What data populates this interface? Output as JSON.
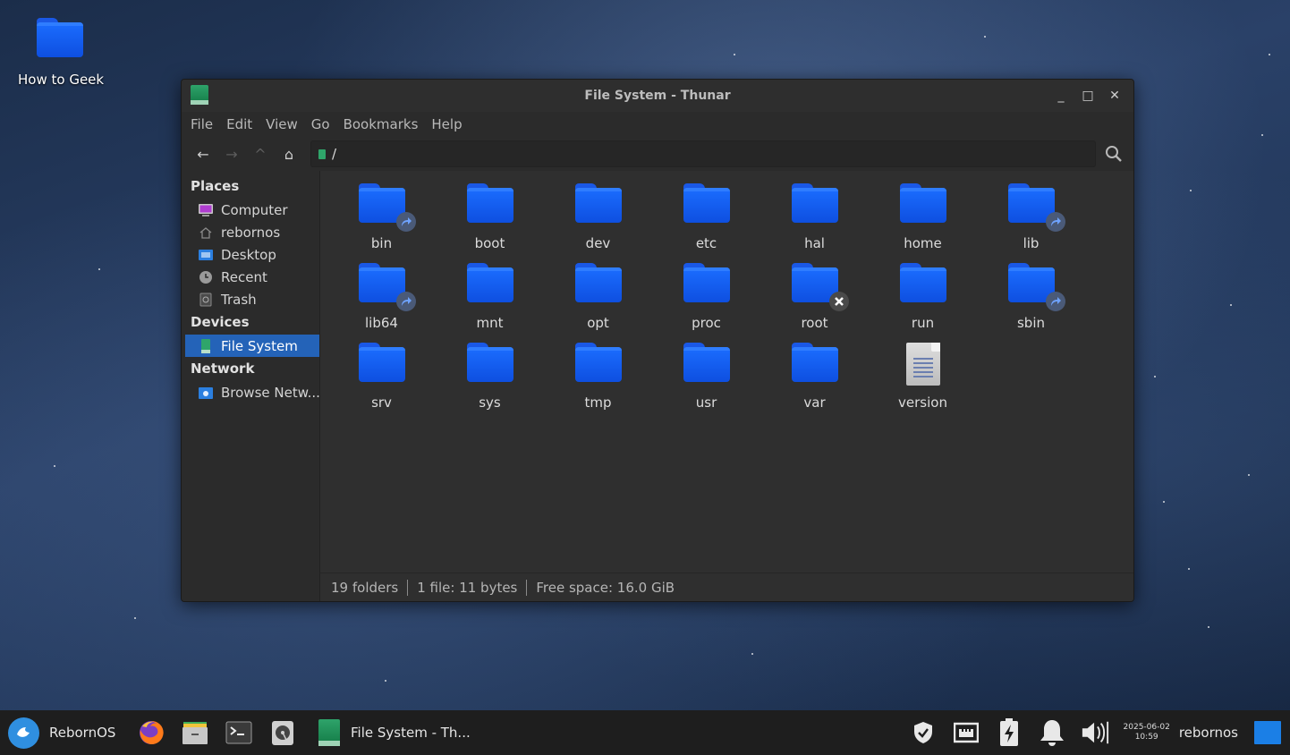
{
  "desktop": {
    "icon_label": "How to Geek"
  },
  "window": {
    "title": "File System - Thunar",
    "controls": {
      "minimize": "_",
      "maximize": "□",
      "close": "✕"
    },
    "menu": [
      "File",
      "Edit",
      "View",
      "Go",
      "Bookmarks",
      "Help"
    ],
    "toolbar": {
      "back": "←",
      "forward": "→",
      "up": "^",
      "home": "⌂",
      "location": "/"
    },
    "sidebar": {
      "places_header": "Places",
      "places": [
        {
          "label": "Computer",
          "icon": "computer-icon"
        },
        {
          "label": "rebornos",
          "icon": "home-icon"
        },
        {
          "label": "Desktop",
          "icon": "desktop-icon"
        },
        {
          "label": "Recent",
          "icon": "clock-icon"
        },
        {
          "label": "Trash",
          "icon": "trash-icon"
        }
      ],
      "devices_header": "Devices",
      "devices": [
        {
          "label": "File System",
          "icon": "drive-icon",
          "active": true
        }
      ],
      "network_header": "Network",
      "network": [
        {
          "label": "Browse Netw...",
          "icon": "network-icon"
        }
      ]
    },
    "files": [
      {
        "name": "bin",
        "type": "folder",
        "badge": "link"
      },
      {
        "name": "boot",
        "type": "folder"
      },
      {
        "name": "dev",
        "type": "folder"
      },
      {
        "name": "etc",
        "type": "folder"
      },
      {
        "name": "hal",
        "type": "folder"
      },
      {
        "name": "home",
        "type": "folder"
      },
      {
        "name": "lib",
        "type": "folder",
        "badge": "link"
      },
      {
        "name": "lib64",
        "type": "folder",
        "badge": "link"
      },
      {
        "name": "mnt",
        "type": "folder"
      },
      {
        "name": "opt",
        "type": "folder"
      },
      {
        "name": "proc",
        "type": "folder"
      },
      {
        "name": "root",
        "type": "folder",
        "badge": "no-access"
      },
      {
        "name": "run",
        "type": "folder"
      },
      {
        "name": "sbin",
        "type": "folder",
        "badge": "link"
      },
      {
        "name": "srv",
        "type": "folder"
      },
      {
        "name": "sys",
        "type": "folder"
      },
      {
        "name": "tmp",
        "type": "folder"
      },
      {
        "name": "usr",
        "type": "folder"
      },
      {
        "name": "var",
        "type": "folder"
      },
      {
        "name": "version",
        "type": "file"
      }
    ],
    "status": {
      "folders": "19 folders",
      "files": "1 file: 11 bytes",
      "free": "Free space: 16.0 GiB"
    }
  },
  "taskbar": {
    "start_label": "RebornOS",
    "launchers": [
      "firefox-icon",
      "file-manager-icon",
      "terminal-icon",
      "disk-icon"
    ],
    "task_label": "File System - Th...",
    "tray": [
      "shield-icon",
      "network-icon",
      "battery-icon",
      "bell-icon",
      "volume-icon"
    ],
    "date": "2025-06-02",
    "time": "10:59",
    "user": "rebornos"
  },
  "colors": {
    "accent": "#2463b8",
    "folder": "#1b6dff",
    "window_bg": "#2b2b2b"
  }
}
